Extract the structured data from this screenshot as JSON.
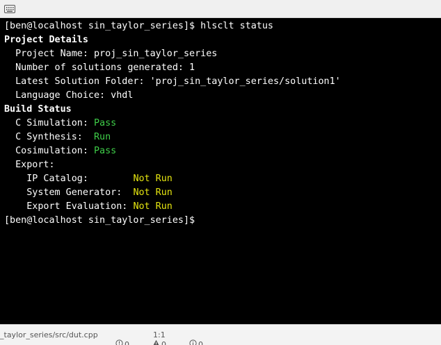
{
  "tabbar": {
    "icon": "keyboard-icon"
  },
  "terminal": {
    "prompt_cmd": "[ben@localhost sin_taylor_series]$ hlsclt status",
    "project_details": "Project Details",
    "project_name": "  Project Name: proj_sin_taylor_series",
    "num_solutions": "  Number of solutions generated: 1",
    "latest_folder": "  Latest Solution Folder: 'proj_sin_taylor_series/solution1'",
    "language": "  Language Choice: vhdl",
    "build_status": "Build Status",
    "csim_label": "  C Simulation: ",
    "csim_value": "Pass",
    "csyn_label": "  C Synthesis:  ",
    "csyn_value": "Run",
    "cosim_label": "  Cosimulation: ",
    "cosim_value": "Pass",
    "export_label": "  Export:",
    "ipcat_label": "    IP Catalog:        ",
    "ipcat_value": "Not Run",
    "sysgen_label": "    System Generator:  ",
    "sysgen_value": "Not Run",
    "expeval_label": "    Export Evaluation: ",
    "expeval_value": "Not Run",
    "prompt_end": "[ben@localhost sin_taylor_series]$"
  },
  "statusbar": {
    "path": "_taylor_series/src/dut.cpp",
    "errors": "0",
    "warnings": "0",
    "infos": "0",
    "position": "1:1"
  },
  "colors": {
    "pass": "#3fcf49",
    "not_run": "#e5e510",
    "background": "#000000"
  }
}
